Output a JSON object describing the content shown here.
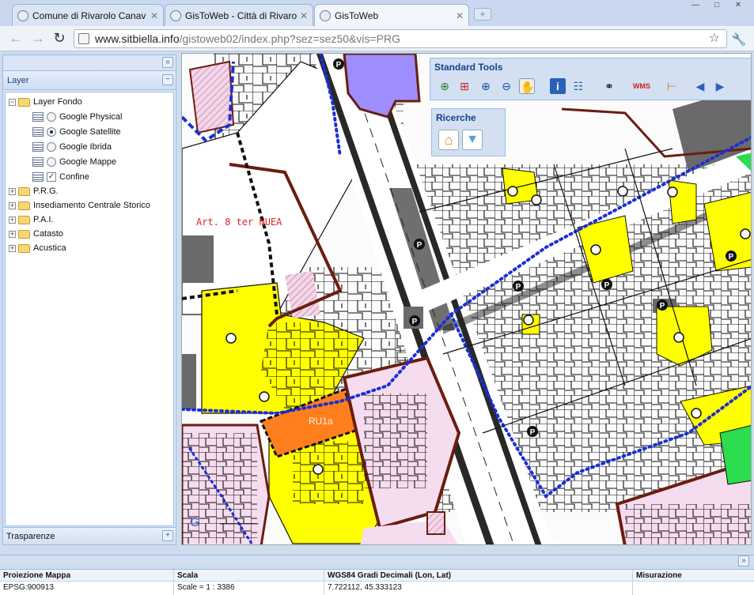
{
  "browser": {
    "tabs": [
      {
        "label": "Comune di Rivarolo Canav",
        "active": false
      },
      {
        "label": "GisToWeb - Città di Rivarol",
        "active": false
      },
      {
        "label": "GisToWeb",
        "active": true
      }
    ],
    "url_host": "www.sitbiella.info",
    "url_path": "/gistoweb02/index.php?sez=sez50&vis=PRG"
  },
  "left_panel": {
    "title": "Layer",
    "tree": [
      {
        "label": "Layer Fondo",
        "expanded": true,
        "children": [
          {
            "label": "Google Physical",
            "control": "radio",
            "selected": false
          },
          {
            "label": "Google Satellite",
            "control": "radio",
            "selected": true
          },
          {
            "label": "Google Ibrida",
            "control": "radio",
            "selected": false
          },
          {
            "label": "Google Mappe",
            "control": "radio",
            "selected": false
          },
          {
            "label": "Confine",
            "control": "checkbox",
            "selected": true
          }
        ]
      },
      {
        "label": "P.R.G.",
        "expanded": false
      },
      {
        "label": "Insediamento Centrale Storico",
        "expanded": false
      },
      {
        "label": "P.A.I.",
        "expanded": false
      },
      {
        "label": "Catasto",
        "expanded": false
      },
      {
        "label": "Acustica",
        "expanded": false
      }
    ],
    "footer_title": "Trasparenze"
  },
  "standard_tools": {
    "title": "Standard Tools",
    "tools": [
      "zoom-extent",
      "zoom-box",
      "zoom-in",
      "zoom-out",
      "pan",
      "info",
      "attribute-table",
      "binoculars",
      "wms",
      "measure",
      "previous-view",
      "next-view"
    ],
    "selected": "pan"
  },
  "ricerche": {
    "title": "Ricerche",
    "tools": [
      "search-address",
      "search-parcel"
    ]
  },
  "map": {
    "labels": [
      "Art. 8 ter NUEA",
      "RU1a"
    ],
    "parking_marker": "P",
    "colors": {
      "prg_yellow": "#ffff00",
      "ru_orange": "#ff7f1e",
      "residential_pink": "#f6dcef",
      "boundary_blue": "#1a2fd6",
      "boundary_brown": "#6b1d10",
      "green_area": "#2bdc4f",
      "purple_area": "#9d8dff",
      "road_grey": "#5f5f5f"
    }
  },
  "status_bar": {
    "columns": [
      {
        "header": "Proiezione Mappa",
        "value": "EPSG:900913"
      },
      {
        "header": "Scala",
        "value": "Scale = 1 : 3386"
      },
      {
        "header": "WGS84 Gradi Decimali (Lon, Lat)",
        "value": "7.722112, 45.333123"
      },
      {
        "header": "Misurazione",
        "value": ""
      }
    ]
  }
}
